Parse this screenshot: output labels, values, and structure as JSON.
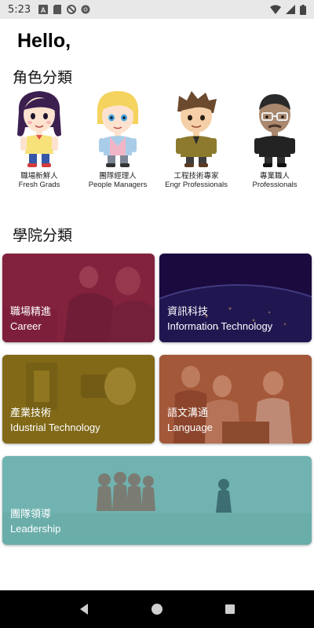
{
  "status_bar": {
    "time": "5:23",
    "left_icons": [
      "a-icon",
      "sd-card-icon",
      "no-disturb-icon",
      "chrome-icon"
    ],
    "right_icons": [
      "wifi-icon",
      "signal-icon",
      "battery-icon"
    ]
  },
  "greeting": "Hello,",
  "roles_section": {
    "title": "角色分類",
    "items": [
      {
        "zh": "職場新鮮人",
        "en": "Fresh Grads",
        "icon": "fresh-grad-avatar"
      },
      {
        "zh": "團隊經理人",
        "en": "People Managers",
        "icon": "manager-avatar"
      },
      {
        "zh": "工程技術專家",
        "en": "Engr Professionals",
        "icon": "engineer-avatar"
      },
      {
        "zh": "專業職人",
        "en": "Professionals",
        "icon": "professional-avatar"
      }
    ]
  },
  "colleges_section": {
    "title": "學院分類",
    "cards": [
      {
        "zh": "職場精進",
        "en": "Career",
        "color": "#8a1f3e"
      },
      {
        "zh": "資訊科技",
        "en": "Information Technology",
        "color": "#1f0d4a"
      },
      {
        "zh": "產業技術",
        "en": "Idustrial Technology",
        "color": "#8a7018"
      },
      {
        "zh": "語文溝通",
        "en": "Language",
        "color": "#9a4a2e"
      },
      {
        "zh": "團隊領導",
        "en": "Leadership",
        "color": "#5aa6a2"
      }
    ]
  },
  "nav_bar": {
    "icons": [
      "back-icon",
      "home-icon",
      "recents-icon"
    ]
  }
}
